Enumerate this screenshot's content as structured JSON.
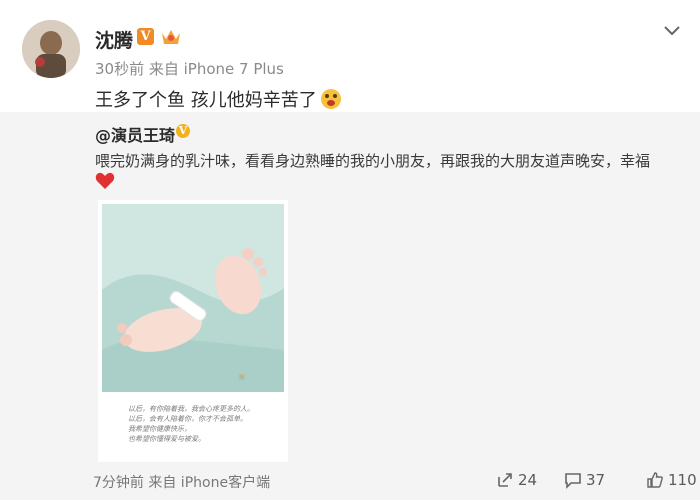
{
  "post": {
    "author": "沈腾",
    "meta": "30秒前 来自 iPhone 7 Plus",
    "text": "王多了个鱼 孩儿他妈辛苦了"
  },
  "repost": {
    "author": "@演员王琦",
    "text": "喂完奶满身的乳汁味，看看身边熟睡的我的小朋友，再跟我的大朋友道声晚安，幸福",
    "photo_note_lines": [
      "以后，有你陪着我，我会心疼更多的人。",
      "以后，会有人陪着你，你才不会孤单。",
      "我希望你健康快乐，",
      "也希望你懂得爱与被爱。"
    ]
  },
  "footer": {
    "time_source": "7分钟前 来自 iPhone客户端",
    "repost_count": "24",
    "comment_count": "37",
    "like_count": "110"
  },
  "icons": {
    "accent_v": "#f08a24",
    "heart_color": "#e0302f"
  }
}
